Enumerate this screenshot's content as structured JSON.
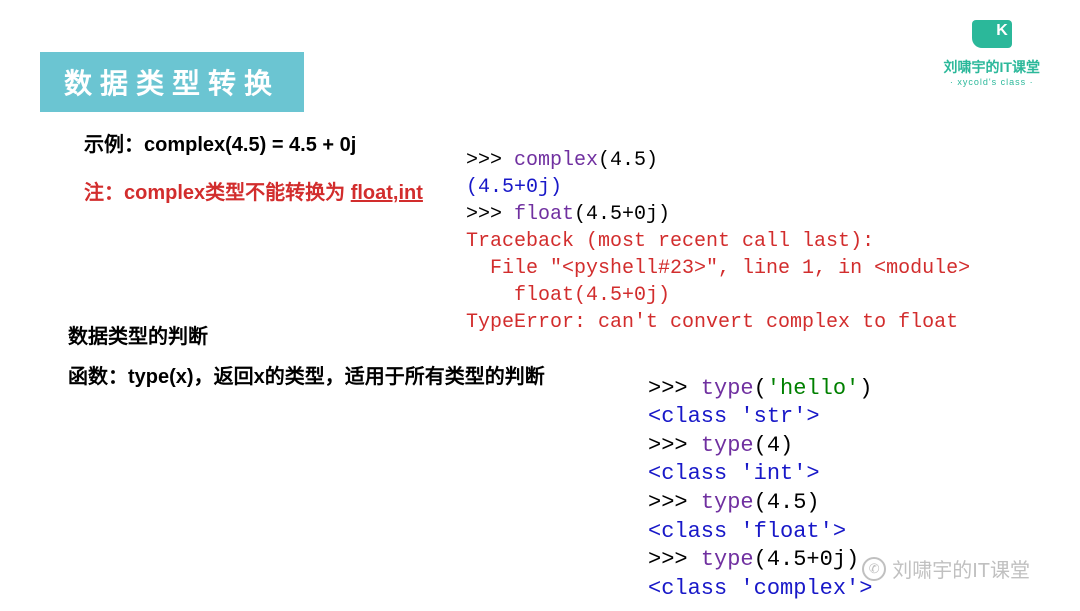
{
  "logo": {
    "title": "刘啸宇的IT课堂",
    "subtitle": "· xycold's class ·"
  },
  "header": {
    "title": "数据类型转换"
  },
  "body": {
    "example": "示例：complex(4.5) = 4.5 + 0j",
    "note_prefix": "注：complex类型不能转换为 ",
    "note_underlined": "float,int",
    "section_heading": "数据类型的判断",
    "function_desc": "函数：type(x)，返回x的类型，适用于所有类型的判断"
  },
  "code1": {
    "l1_prompt": ">>> ",
    "l1_fn": "complex",
    "l1_rest": "(4.5)",
    "l2": "(4.5+0j)",
    "l3_prompt": ">>> ",
    "l3_fn": "float",
    "l3_rest": "(4.5+0j)",
    "l4": "Traceback (most recent call last):",
    "l5a": "  File ",
    "l5b": "\"<pyshell#23>\"",
    "l5c": ", line 1, in <module>",
    "l6": "    float(4.5+0j)",
    "l7": "TypeError: can't convert complex to float"
  },
  "code2": {
    "l1_prompt": ">>> ",
    "l1_fn": "type",
    "l1_paren_open": "(",
    "l1_arg": "'hello'",
    "l1_paren_close": ")",
    "l2": "<class 'str'>",
    "l3_prompt": ">>> ",
    "l3_fn": "type",
    "l3_rest": "(4)",
    "l4": "<class 'int'>",
    "l5_prompt": ">>> ",
    "l5_fn": "type",
    "l5_rest": "(4.5)",
    "l6": "<class 'float'>",
    "l7_prompt": ">>> ",
    "l7_fn": "type",
    "l7_rest": "(4.5+0j)",
    "l8": "<class 'complex'>"
  },
  "watermark": {
    "text": "刘啸宇的IT课堂"
  }
}
